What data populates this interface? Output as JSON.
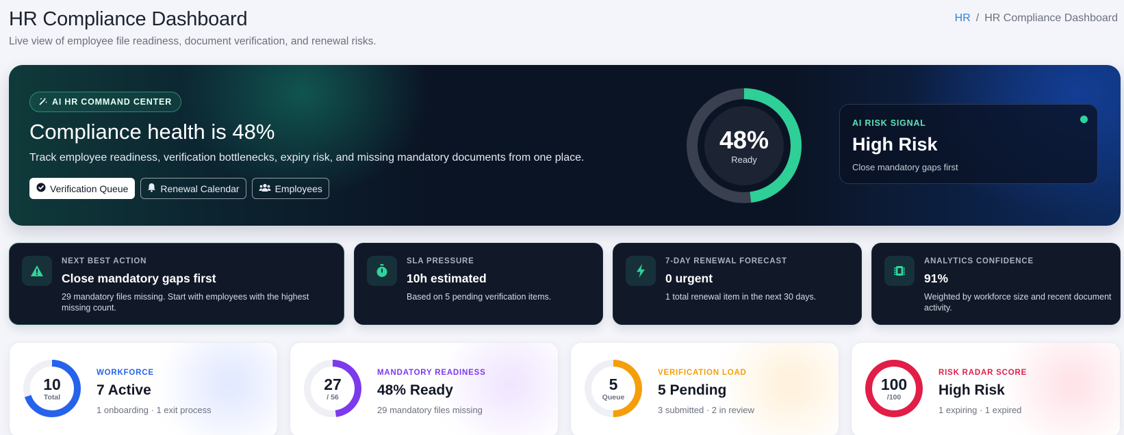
{
  "header": {
    "title": "HR Compliance Dashboard",
    "subtitle": "Live view of employee file readiness, document verification, and renewal risks.",
    "breadcrumb": {
      "root": "HR",
      "separator": "/",
      "current": "HR Compliance Dashboard"
    }
  },
  "hero": {
    "pill": "AI HR COMMAND CENTER",
    "title": "Compliance health is 48%",
    "description": "Track employee readiness, verification bottlenecks, expiry risk, and missing mandatory documents from one place.",
    "buttons": {
      "verification": "Verification Queue",
      "renewal": "Renewal Calendar",
      "employees": "Employees"
    },
    "donut": {
      "value_text": "48%",
      "label": "Ready",
      "fraction": 0.48,
      "color": "#2fcf98"
    },
    "risk": {
      "label": "AI RISK SIGNAL",
      "title": "High Risk",
      "description": "Close mandatory gaps first"
    }
  },
  "insights": [
    {
      "label": "NEXT BEST ACTION",
      "title": "Close mandatory gaps first",
      "description": "29 mandatory files missing. Start with employees with the highest missing count.",
      "icon": "warning-icon"
    },
    {
      "label": "SLA PRESSURE",
      "title": "10h estimated",
      "description": "Based on 5 pending verification items.",
      "icon": "stopwatch-icon"
    },
    {
      "label": "7-DAY RENEWAL FORECAST",
      "title": "0 urgent",
      "description": "1 total renewal item in the next 30 days.",
      "icon": "bolt-icon"
    },
    {
      "label": "ANALYTICS CONFIDENCE",
      "title": "91%",
      "description": "Weighted by workforce size and recent document activity.",
      "icon": "chip-icon"
    }
  ],
  "metrics": [
    {
      "label": "WORKFORCE",
      "title": "7 Active",
      "description": "1 onboarding · 1 exit process",
      "ring_value": "10",
      "ring_sub": "Total",
      "fraction": 0.7,
      "color": "#2563eb",
      "glow": "#dfe6ff"
    },
    {
      "label": "MANDATORY READINESS",
      "title": "48% Ready",
      "description": "29 mandatory files missing",
      "ring_value": "27",
      "ring_sub": "/ 56",
      "fraction": 0.48,
      "color": "#7c3aed",
      "glow": "#efe3ff"
    },
    {
      "label": "VERIFICATION LOAD",
      "title": "5 Pending",
      "description": "3 submitted · 2 in review",
      "ring_value": "5",
      "ring_sub": "Queue",
      "fraction": 0.5,
      "color": "#f59e0b",
      "glow": "#fff0d8"
    },
    {
      "label": "RISK RADAR SCORE",
      "title": "High Risk",
      "description": "1 expiring · 1 expired",
      "ring_value": "100",
      "ring_sub": "/100",
      "fraction": 1.0,
      "color": "#e11d48",
      "glow": "#ffe0e6"
    }
  ],
  "colors": {
    "metric_labels": [
      "#2563eb",
      "#7c3aed",
      "#f59e0b",
      "#e11d48"
    ],
    "insight_icon": "#2fd49a"
  }
}
